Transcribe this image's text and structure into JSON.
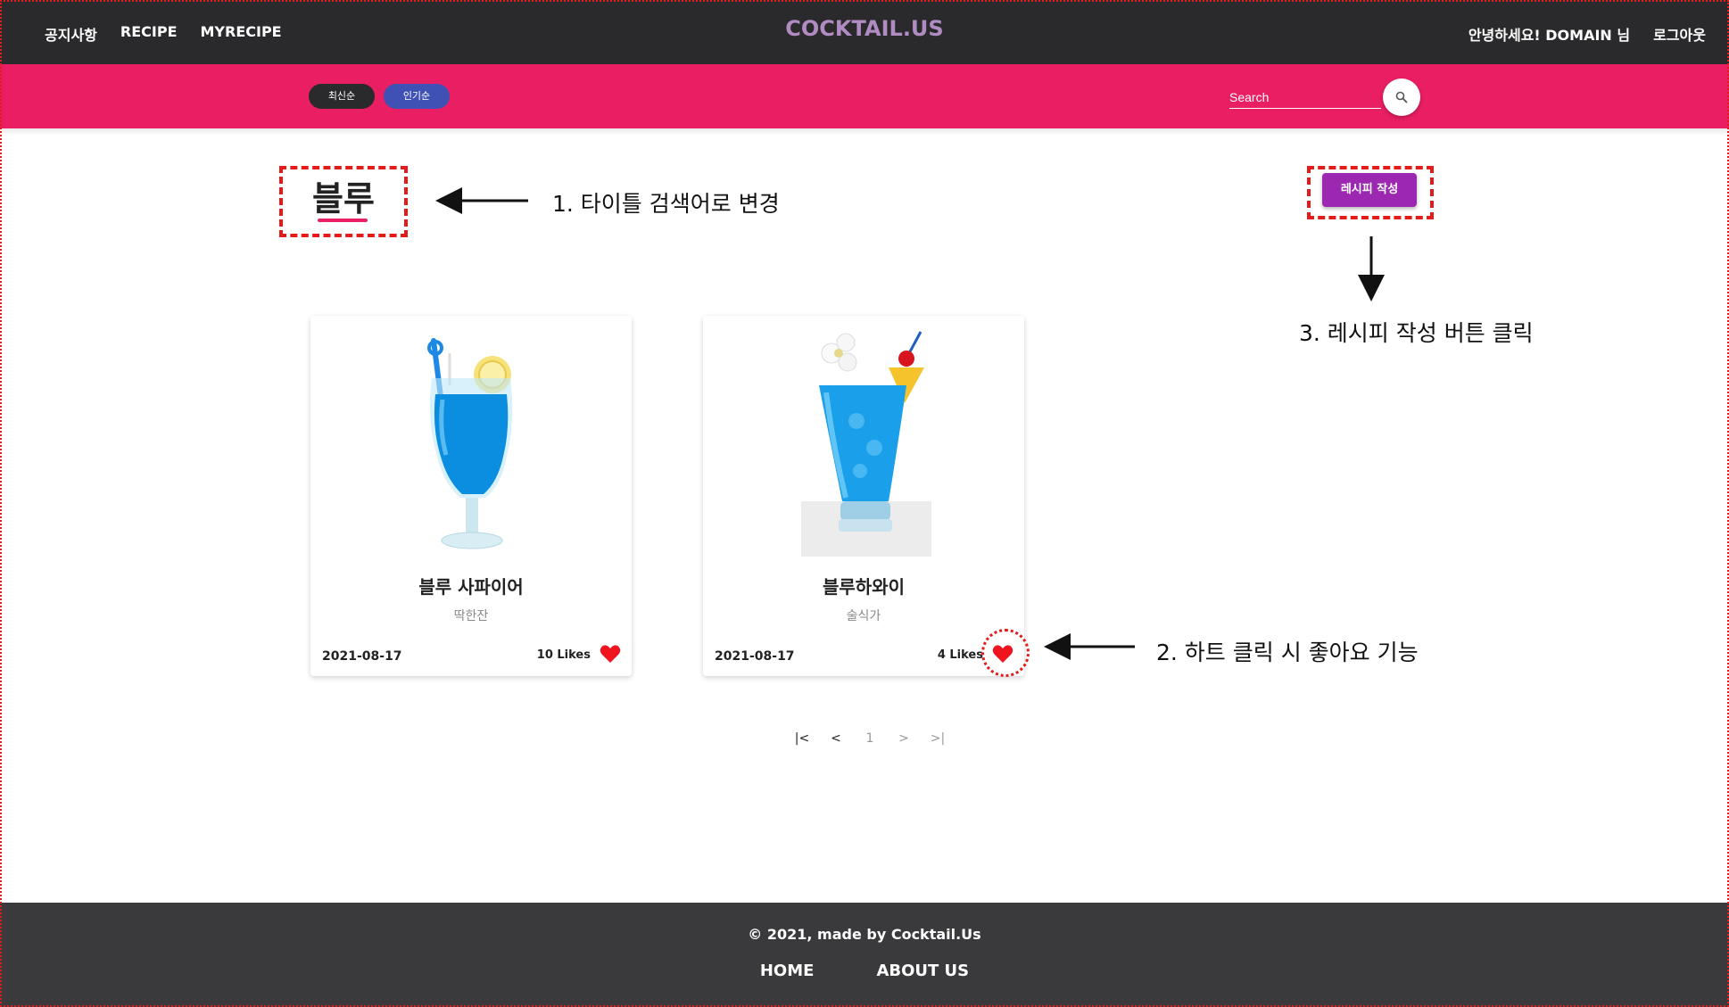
{
  "nav": {
    "items": [
      {
        "label": "공지사항"
      },
      {
        "label": "RECIPE"
      },
      {
        "label": "MYRECIPE"
      }
    ],
    "logo": "COCKTAIL.US",
    "greeting": "안녕하세요! DOMAIN 님",
    "logout": "로그아웃"
  },
  "toolbar": {
    "sort_latest": "최신순",
    "sort_popular": "인기순",
    "search_placeholder": "Search"
  },
  "main": {
    "title": "블루",
    "write_button": "레시피 작성"
  },
  "annotations": {
    "title_note": "1. 타이틀 검색어로 변경",
    "heart_note": "2. 하트 클릭 시 좋아요 기능",
    "write_note": "3. 레시피 작성 버튼 클릭"
  },
  "cards": [
    {
      "title": "블루 사파이어",
      "author": "딱한잔",
      "date": "2021-08-17",
      "likes": "10 Likes"
    },
    {
      "title": "블루하와이",
      "author": "술식가",
      "date": "2021-08-17",
      "likes": "4 Likes"
    }
  ],
  "pagination": {
    "first": "|<",
    "prev": "<",
    "current": "1",
    "next": ">",
    "last": ">|"
  },
  "footer": {
    "copyright": "© 2021, made by Cocktail.Us",
    "links": [
      {
        "label": "HOME"
      },
      {
        "label": "ABOUT US"
      }
    ]
  },
  "colors": {
    "nav_bg": "#2a2a2c",
    "accent_pink": "#e91e63",
    "write_button": "#9c27b0",
    "popular_button": "#3f51b5",
    "annotation_red": "#e31b1b",
    "heart": "#f0141e"
  }
}
